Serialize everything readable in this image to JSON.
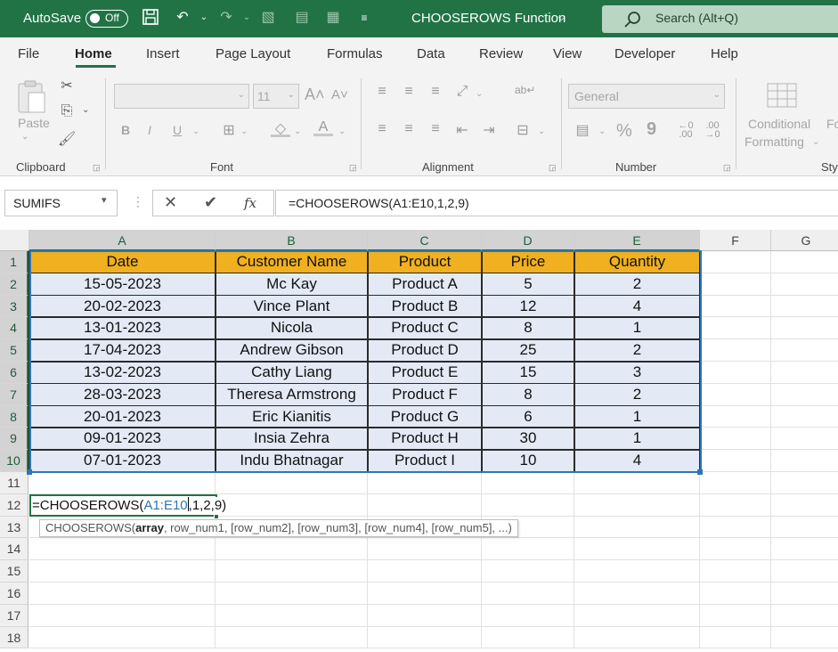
{
  "titlebar": {
    "autosave_label": "AutoSave",
    "autosave_state": "Off",
    "doc_title": "CHOOSEROWS Function",
    "search_placeholder": "Search (Alt+Q)"
  },
  "tabs": [
    {
      "label": "File"
    },
    {
      "label": "Home",
      "active": true
    },
    {
      "label": "Insert"
    },
    {
      "label": "Page Layout"
    },
    {
      "label": "Formulas"
    },
    {
      "label": "Data"
    },
    {
      "label": "Review"
    },
    {
      "label": "View"
    },
    {
      "label": "Developer"
    },
    {
      "label": "Help"
    }
  ],
  "ribbon": {
    "clipboard": {
      "label": "Clipboard",
      "paste": "Paste"
    },
    "font": {
      "label": "Font",
      "size": "11",
      "bold": "B",
      "italic": "I",
      "underline": "U"
    },
    "alignment": {
      "label": "Alignment"
    },
    "number": {
      "label": "Number",
      "format": "General",
      "percent": "%",
      "comma": "9"
    },
    "styles": {
      "conditional_line1": "Conditional",
      "conditional_line2": "Formatting",
      "cut_label": "Sty",
      "format_cut": "Fo"
    }
  },
  "formula_bar": {
    "name_box": "SUMIFS",
    "fx": "fx",
    "formula": "=CHOOSEROWS(A1:E10,1,2,9)"
  },
  "columns": [
    "A",
    "B",
    "C",
    "D",
    "E",
    "F",
    "G"
  ],
  "rows": [
    "1",
    "2",
    "3",
    "4",
    "5",
    "6",
    "7",
    "8",
    "9",
    "10",
    "11",
    "12",
    "13",
    "14",
    "15",
    "16",
    "17",
    "18"
  ],
  "table": {
    "headers": [
      "Date",
      "Customer Name",
      "Product",
      "Price",
      "Quantity"
    ],
    "rows": [
      [
        "15-05-2023",
        "Mc Kay",
        "Product A",
        "5",
        "2"
      ],
      [
        "20-02-2023",
        "Vince Plant",
        "Product B",
        "12",
        "4"
      ],
      [
        "13-01-2023",
        "Nicola",
        "Product C",
        "8",
        "1"
      ],
      [
        "17-04-2023",
        "Andrew Gibson",
        "Product D",
        "25",
        "2"
      ],
      [
        "13-02-2023",
        "Cathy Liang",
        "Product E",
        "15",
        "3"
      ],
      [
        "28-03-2023",
        "Theresa Armstrong",
        "Product F",
        "8",
        "2"
      ],
      [
        "20-01-2023",
        "Eric Kianitis",
        "Product G",
        "6",
        "1"
      ],
      [
        "09-01-2023",
        "Insia Zehra",
        "Product H",
        "30",
        "1"
      ],
      [
        "07-01-2023",
        "Indu Bhatnagar",
        "Product I",
        "10",
        "4"
      ]
    ]
  },
  "edit_cell": {
    "prefix": "=CHOOSEROWS(",
    "ref": "A1:E10",
    "suffix": ",1,2,9)"
  },
  "tooltip": {
    "func": "CHOOSEROWS(",
    "bold_arg": "array",
    "rest": ", row_num1, [row_num2], [row_num3], [row_num4], [row_num5], ...)"
  },
  "colors": {
    "excel_green": "#217346",
    "header_fill": "#f0b020",
    "body_fill": "#e3eaf6",
    "ref_blue": "#2f75b5"
  }
}
